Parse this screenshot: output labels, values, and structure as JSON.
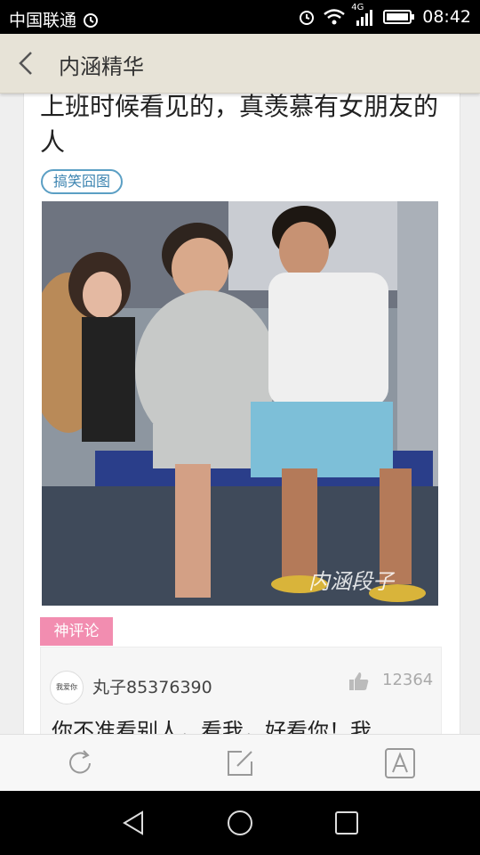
{
  "status_bar": {
    "carrier": "中国联通",
    "network": "4G",
    "time": "08:42"
  },
  "header": {
    "title": "内涵精华"
  },
  "post": {
    "title": "上班时候看见的，真羡慕有女朋友的人",
    "tag": "搞笑囧图",
    "image_watermark": "内涵段子"
  },
  "comments_section": {
    "label": "神评论",
    "comment": {
      "avatar_text": "我爱你",
      "username": "丸子85376390",
      "likes": "12364",
      "text": "你不准看别人，看我，好看你！我"
    }
  },
  "icons": {
    "back": "chevron-left-icon",
    "refresh": "refresh-icon",
    "share": "share-icon",
    "font_size": "font-size-icon",
    "like": "thumbs-up-icon"
  },
  "colors": {
    "header_bg": "#e7e3d7",
    "tag_border": "#5b9fc4",
    "comment_label_bg": "#f28db0"
  }
}
